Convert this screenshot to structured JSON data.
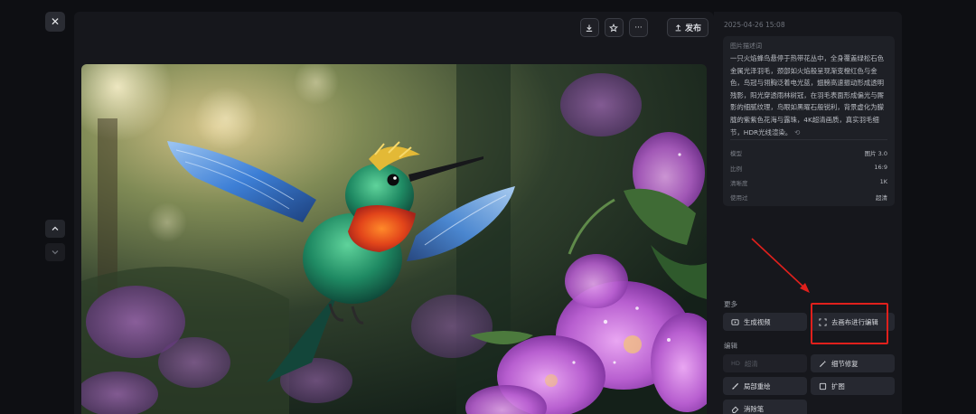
{
  "window": {
    "close_glyph": "✕"
  },
  "nav": {
    "up_icon": "chevron-up",
    "down_icon": "chevron-down"
  },
  "toolbar": {
    "download_icon": "download-icon",
    "favorite_icon": "star-icon",
    "more_glyph": "···",
    "publish_label": "发布"
  },
  "image": {
    "subject": "hummingbird-and-flowers"
  },
  "details": {
    "timestamp": "2025-04-26 15:08",
    "prompt_title": "图片描述词",
    "prompt_text": "一只火焰蜂鸟悬停于热带花丛中，全身覆盖绿松石色金属光泽羽毛，颈部如火焰般呈现渐变橙红色与金色，鸟冠与翎胸泛着电光蓝，翅膀高速振动形成透明残影，阳光穿透雨林树冠，在羽毛表面形成偏光与厮影的细腻纹理，鸟眼如黑曜石般锐利，背景虚化为朦胧的紫紫色花海与露珠，4K超清画质，真实羽毛细节，HDR光线渲染。",
    "meta": [
      {
        "key": "模型",
        "value": "图片 3.0"
      },
      {
        "key": "比例",
        "value": "16:9"
      },
      {
        "key": "清晰度",
        "value": "1K"
      },
      {
        "key": "使用过",
        "value": "超清"
      }
    ]
  },
  "more_section": {
    "label": "更多",
    "generate_video": "生成视频",
    "canvas_edit": "去画布进行编辑"
  },
  "edit_section": {
    "label": "编辑",
    "hd_badge": "HD",
    "hd_label": "超清",
    "detail_fix": "细节修复",
    "local_redraw": "局部重绘",
    "expand": "扩图",
    "eraser": "消除笔"
  },
  "colors": {
    "accent_red": "#e0201c",
    "panel_bg": "#16171c",
    "button_bg": "#262830"
  }
}
